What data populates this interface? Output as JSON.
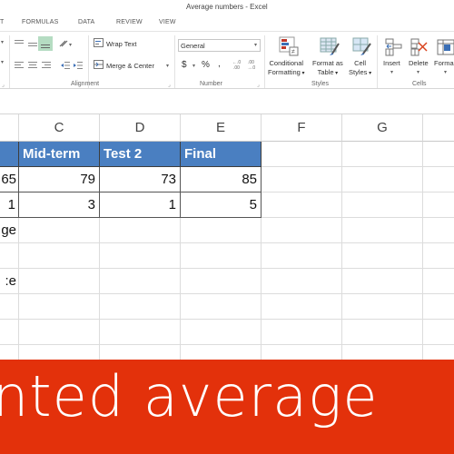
{
  "window": {
    "title": "Average numbers - Excel"
  },
  "tabs": [
    "T",
    "FORMULAS",
    "DATA",
    "REVIEW",
    "VIEW"
  ],
  "ribbon": {
    "alignment": {
      "label": "Alignment",
      "wrap_text": "Wrap Text",
      "merge_center": "Merge & Center"
    },
    "number": {
      "label": "Number",
      "format_value": "General",
      "currency": "$",
      "percent": "%",
      "comma": ","
    },
    "styles": {
      "label": "Styles",
      "conditional_formatting": [
        "Conditional",
        "Formatting"
      ],
      "format_as_table": [
        "Format as",
        "Table"
      ],
      "cell_styles": [
        "Cell",
        "Styles"
      ]
    },
    "cells": {
      "label": "Cells",
      "insert": "Insert",
      "delete": "Delete",
      "format": "Forma"
    }
  },
  "sheet": {
    "columns": [
      "C",
      "D",
      "E",
      "F",
      "G"
    ],
    "header_row": {
      "b": "",
      "c": "Mid-term",
      "d": "Test 2",
      "e": "Final"
    },
    "scores_row": {
      "b": "65",
      "c": "79",
      "d": "73",
      "e": "85"
    },
    "weights_row": {
      "b": "1",
      "c": "3",
      "d": "1",
      "e": "5"
    },
    "row_labels": [
      "ge:",
      "e:"
    ]
  },
  "banner": {
    "text": "nted average",
    "color": "#e3310b"
  },
  "colors": {
    "header_fill": "#4a7fc1",
    "selected_align": "#b5dcc2"
  }
}
